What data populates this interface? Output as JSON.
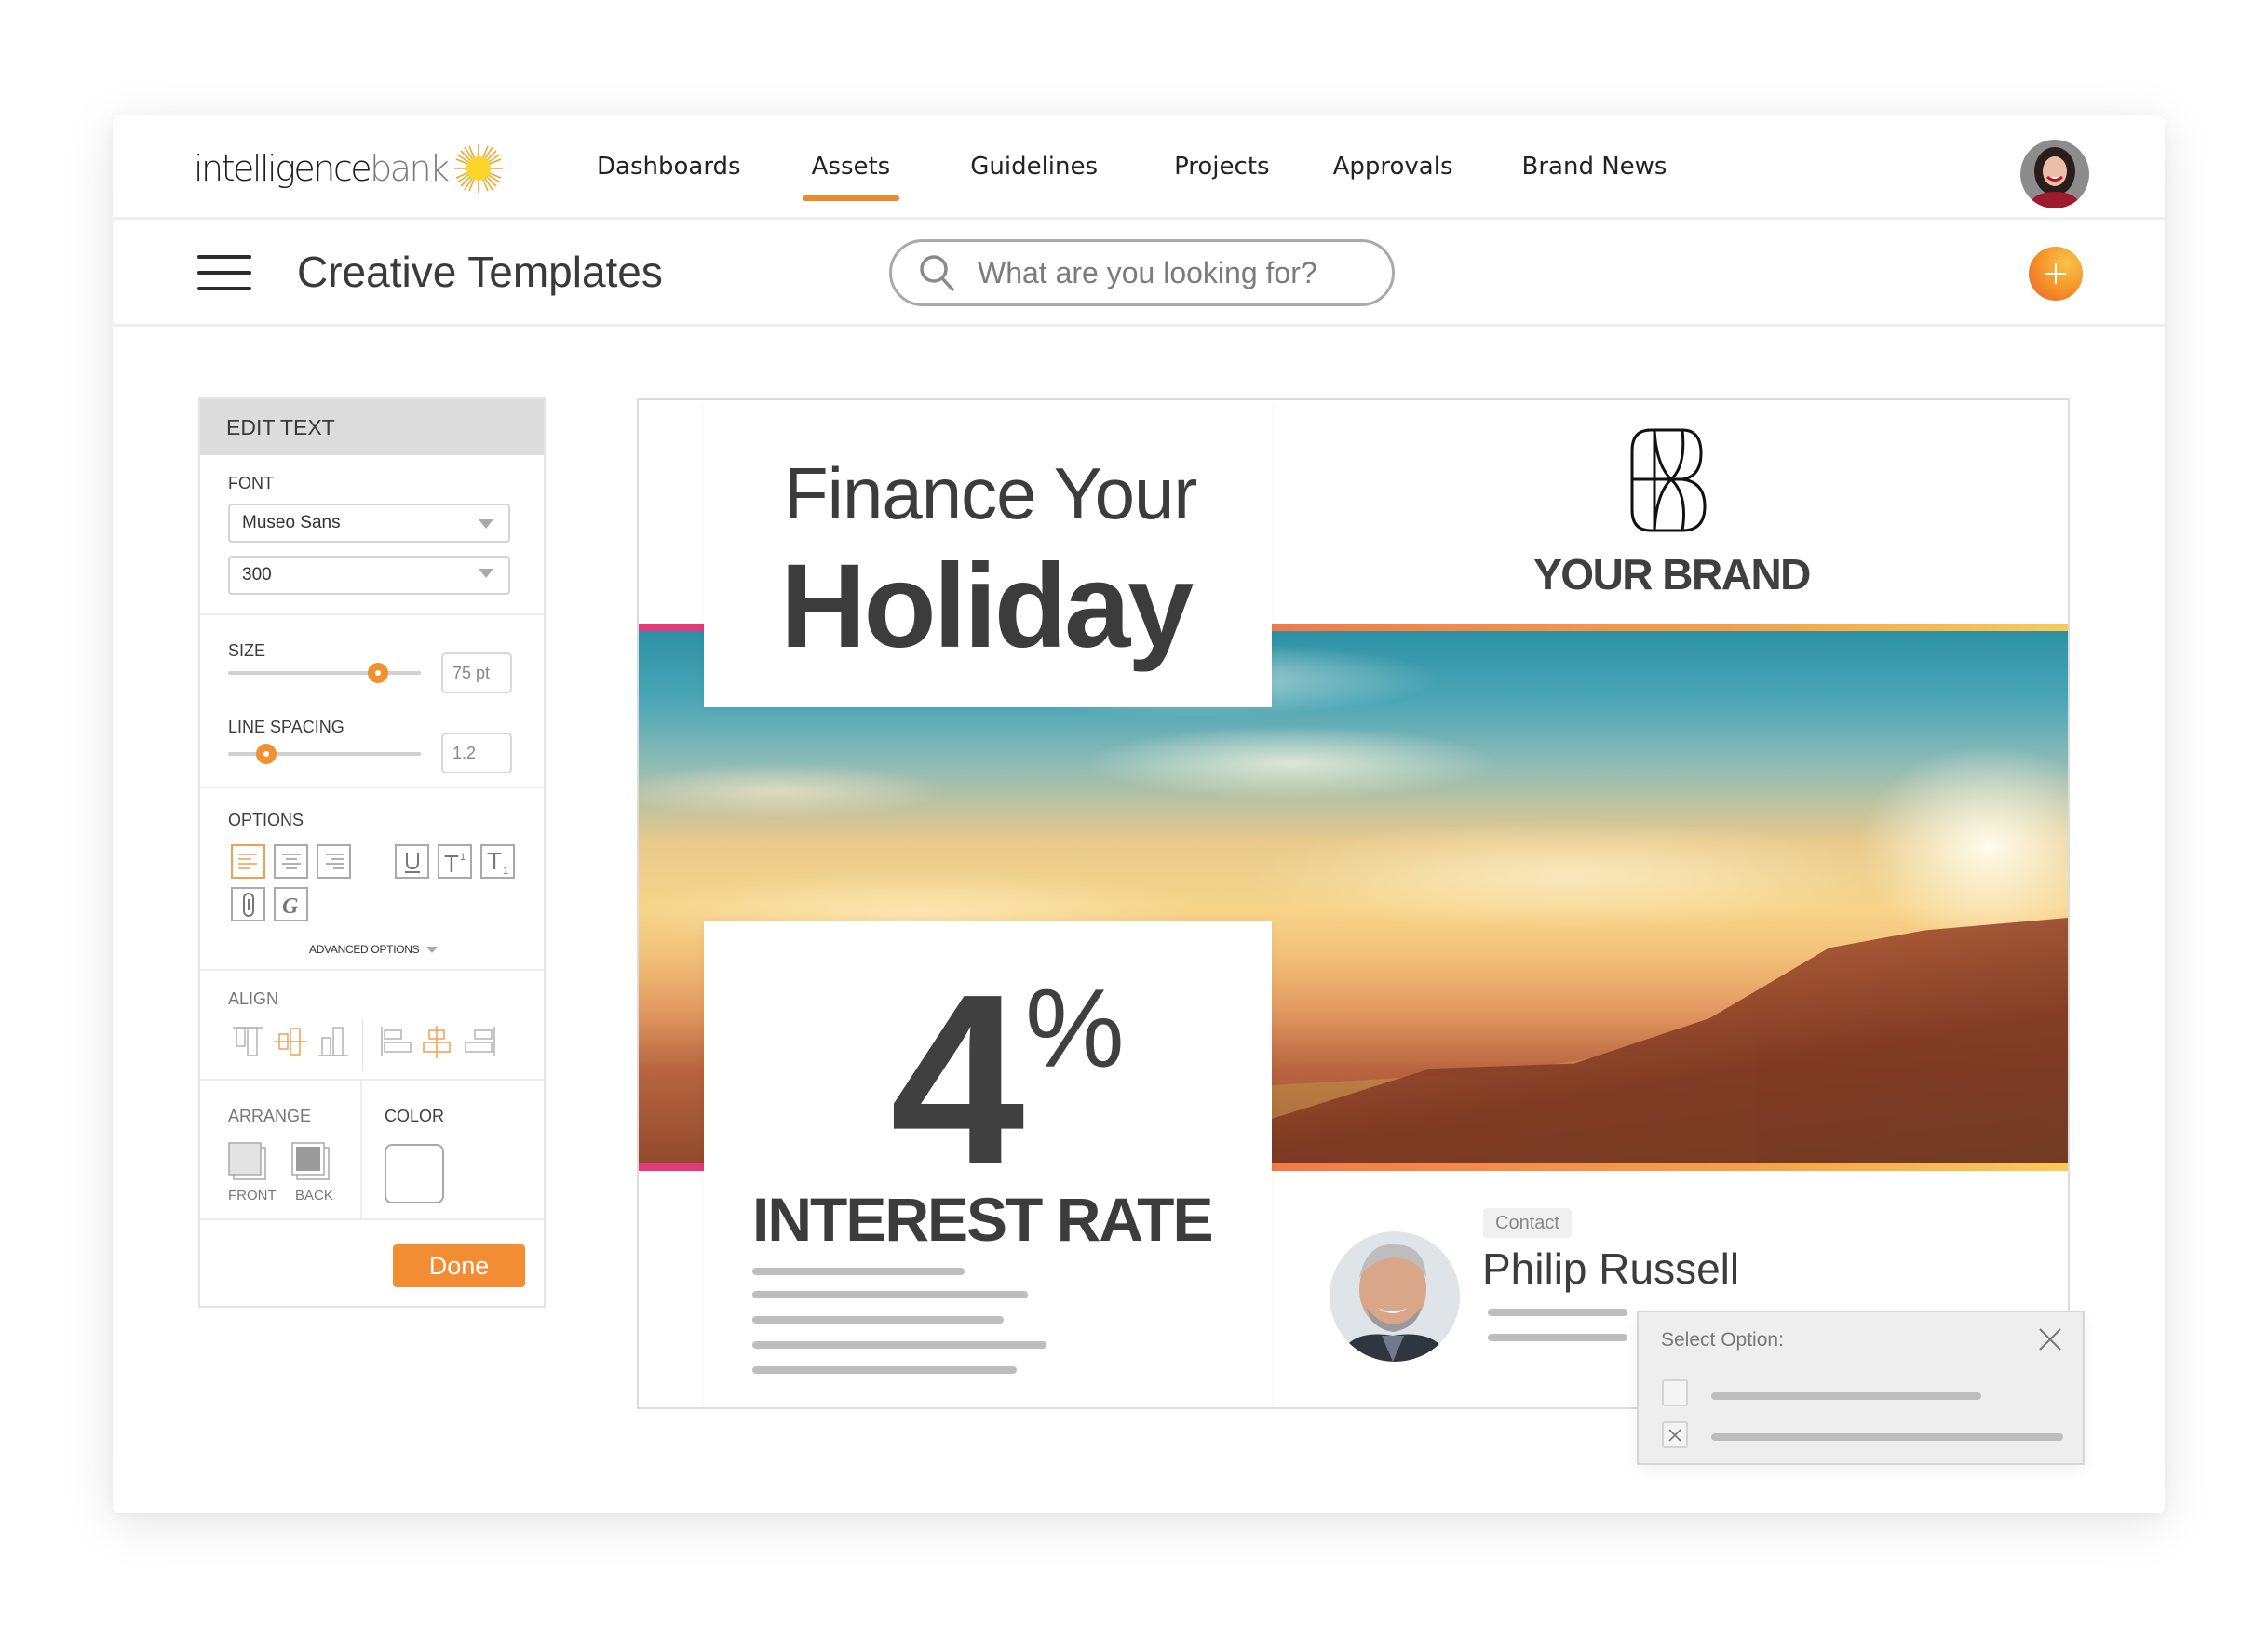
{
  "brand": {
    "logo_word_1": "intelligence",
    "logo_word_2": "bank"
  },
  "nav": {
    "items": [
      {
        "label": "Dashboards",
        "active": false
      },
      {
        "label": "Assets",
        "active": true
      },
      {
        "label": "Guidelines",
        "active": false
      },
      {
        "label": "Projects",
        "active": false
      },
      {
        "label": "Approvals",
        "active": false
      },
      {
        "label": "Brand News",
        "active": false
      }
    ]
  },
  "subbar": {
    "title": "Creative Templates",
    "search_placeholder": "What are you looking for?"
  },
  "edit_panel": {
    "header": "EDIT TEXT",
    "font_label": "FONT",
    "font_family": "Museo Sans",
    "font_weight": "300",
    "size_label": "SIZE",
    "size_value": "75 pt",
    "size_slider_fraction": 0.78,
    "line_spacing_label": "LINE SPACING",
    "line_spacing_value": "1.2",
    "line_spacing_slider_fraction": 0.2,
    "options_label": "OPTIONS",
    "options": [
      {
        "icon": "align-left-icon",
        "active": true
      },
      {
        "icon": "align-center-icon",
        "active": false
      },
      {
        "icon": "align-right-icon",
        "active": false
      },
      {
        "icon": "underline-icon",
        "active": false
      },
      {
        "icon": "superscript-icon",
        "active": false
      },
      {
        "icon": "subscript-icon",
        "active": false
      },
      {
        "icon": "link-icon",
        "active": false
      },
      {
        "icon": "script-font-icon",
        "active": false
      }
    ],
    "advanced_options_label": "ADVANCED OPTIONS",
    "align_label": "ALIGN",
    "align_vertical_active": "middle",
    "align_horizontal_active": "center",
    "arrange_label": "ARRANGE",
    "front_label": "FRONT",
    "back_label": "BACK",
    "color_label": "COLOR",
    "color_value": "#ffffff",
    "done_label": "Done"
  },
  "template": {
    "headline_line1": "Finance Your",
    "headline_line2": "Holiday",
    "brand_name": "YOUR BRAND",
    "rate_number": "4",
    "rate_symbol": "%",
    "rate_label": "INTEREST RATE",
    "contact_tag": "Contact",
    "contact_name": "Philip Russell"
  },
  "popup": {
    "title": "Select Option:",
    "options": [
      {
        "checked": false
      },
      {
        "checked": true
      }
    ]
  },
  "colors": {
    "accent": "#f38d33",
    "nav_underline": "#ea8a2c",
    "accent_pink": "#e43a7c"
  }
}
